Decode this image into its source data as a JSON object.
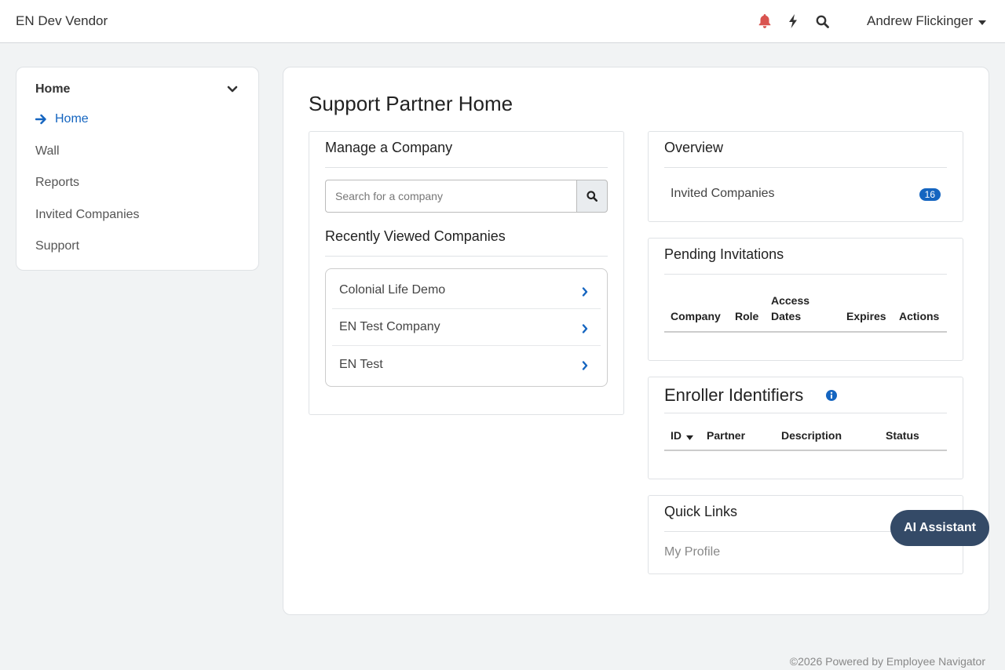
{
  "topbar": {
    "brand": "EN Dev Vendor",
    "user_name": "Andrew Flickinger",
    "colors": {
      "bell": "#d9534f",
      "icon": "#333333"
    }
  },
  "sidebar": {
    "header": "Home",
    "items": [
      {
        "label": "Home",
        "active": true
      },
      {
        "label": "Wall"
      },
      {
        "label": "Reports"
      },
      {
        "label": "Invited Companies"
      },
      {
        "label": "Support"
      }
    ]
  },
  "main": {
    "title": "Support Partner Home",
    "manage": {
      "title": "Manage a Company",
      "search_placeholder": "Search for a company",
      "recent_title": "Recently Viewed Companies",
      "recent": [
        "Colonial Life Demo",
        "EN Test Company",
        "EN Test"
      ]
    },
    "overview": {
      "title": "Overview",
      "row_label": "Invited Companies",
      "row_count": "16"
    },
    "pending": {
      "title": "Pending Invitations",
      "columns": [
        "Company",
        "Role",
        "Access\nDates",
        "Expires",
        "Actions"
      ]
    },
    "enroller": {
      "title": "Enroller Identifiers",
      "columns": [
        "ID",
        "Partner",
        "Description",
        "Status"
      ]
    },
    "quick_links": {
      "title": "Quick Links",
      "links": [
        "My Profile"
      ]
    }
  },
  "ai_assistant": "AI Assistant",
  "footer": "©2026 Powered by Employee Navigator",
  "accent_color": "#1565c0"
}
